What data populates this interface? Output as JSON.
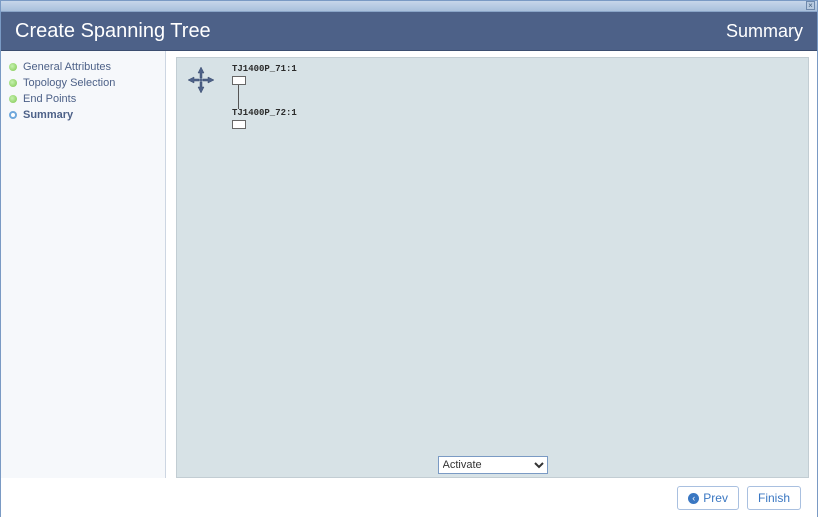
{
  "window": {
    "close_tooltip": "Close"
  },
  "header": {
    "title": "Create Spanning Tree",
    "subtitle": "Summary"
  },
  "sidebar": {
    "items": [
      {
        "label": "General Attributes",
        "state": "done"
      },
      {
        "label": "Topology Selection",
        "state": "done"
      },
      {
        "label": "End Points",
        "state": "done"
      },
      {
        "label": "Summary",
        "state": "current"
      }
    ]
  },
  "canvas": {
    "nodes": [
      {
        "label": "TJ1400P_71:1"
      },
      {
        "label": "TJ1400P_72:1"
      }
    ],
    "action_select": {
      "options": [
        "Activate"
      ],
      "selected": "Activate"
    }
  },
  "footer": {
    "prev_label": "Prev",
    "finish_label": "Finish"
  }
}
